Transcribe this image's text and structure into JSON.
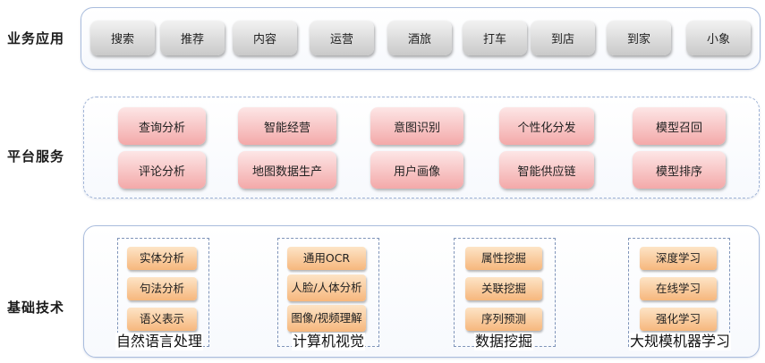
{
  "rows": {
    "business": {
      "label": "业务应用",
      "items": [
        "搜索",
        "推荐",
        "内容",
        "运营",
        "酒旅",
        "打车",
        "到店",
        "到家",
        "小象"
      ]
    },
    "platform": {
      "label": "平台服务",
      "items": [
        "查询分析",
        "智能经营",
        "意图识别",
        "个性化分发",
        "模型召回",
        "评论分析",
        "地图数据生产",
        "用户画像",
        "智能供应链",
        "模型排序"
      ]
    },
    "foundation": {
      "label": "基础技术",
      "groups": [
        {
          "title": "自然语言处理",
          "items": [
            "实体分析",
            "句法分析",
            "语义表示"
          ]
        },
        {
          "title": "计算机视觉",
          "items": [
            "通用OCR",
            "人脸/人体分析",
            "图像/视频理解"
          ]
        },
        {
          "title": "数据挖掘",
          "items": [
            "属性挖掘",
            "关联挖掘",
            "序列预测"
          ]
        },
        {
          "title": "大规模机器学习",
          "items": [
            "深度学习",
            "在线学习",
            "强化学习"
          ]
        }
      ]
    }
  },
  "colors": {
    "panel_border": "#a9bcdd",
    "business_button": "#d6d6d6",
    "platform_button": "#f6b7b7",
    "foundation_button": "#f8c48f"
  }
}
